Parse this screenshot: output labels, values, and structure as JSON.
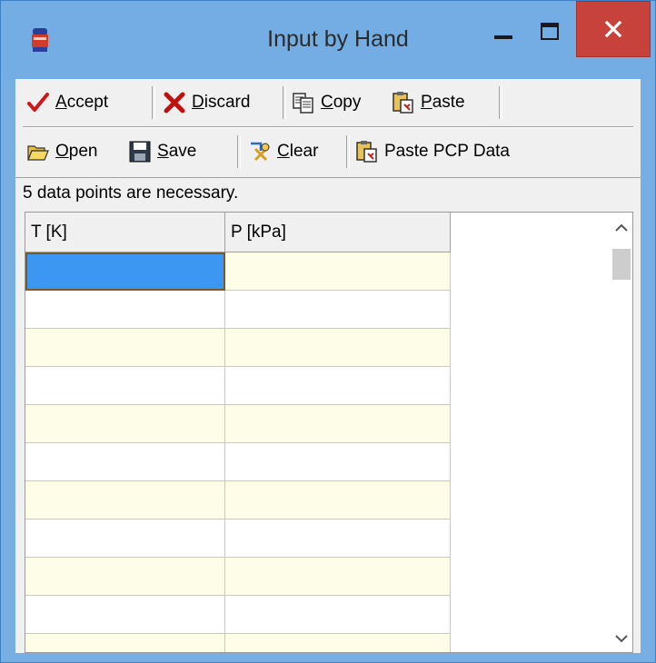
{
  "window": {
    "title": "Input by Hand"
  },
  "toolbar1": {
    "accept": {
      "label": "Accept",
      "accel": "A",
      "rest": "ccept"
    },
    "discard": {
      "label": "Discard",
      "accel": "D",
      "rest": "iscard"
    },
    "copy": {
      "label": "Copy",
      "accel": "C",
      "rest": "opy"
    },
    "paste": {
      "label": "Paste",
      "accel": "P",
      "rest": "aste"
    }
  },
  "toolbar2": {
    "open": {
      "label": "Open",
      "accel": "O",
      "rest": "pen"
    },
    "save": {
      "label": "Save",
      "accel": "S",
      "rest": "ave"
    },
    "clear": {
      "label": "Clear",
      "accel": "C",
      "rest": "lear"
    },
    "paste_pcp": {
      "label": "Paste PCP Data"
    }
  },
  "status": "5 data points are necessary.",
  "table": {
    "columns": [
      "T [K]",
      "P [kPa]"
    ],
    "rows": [
      [
        "",
        ""
      ],
      [
        "",
        ""
      ],
      [
        "",
        ""
      ],
      [
        "",
        ""
      ],
      [
        "",
        ""
      ],
      [
        "",
        ""
      ],
      [
        "",
        ""
      ],
      [
        "",
        ""
      ],
      [
        "",
        ""
      ],
      [
        "",
        ""
      ],
      [
        "",
        ""
      ]
    ]
  },
  "colors": {
    "titlebar": "#74ade3",
    "close": "#c7423a",
    "selected_cell": "#3b97f2",
    "alt_row": "#fefde8"
  }
}
